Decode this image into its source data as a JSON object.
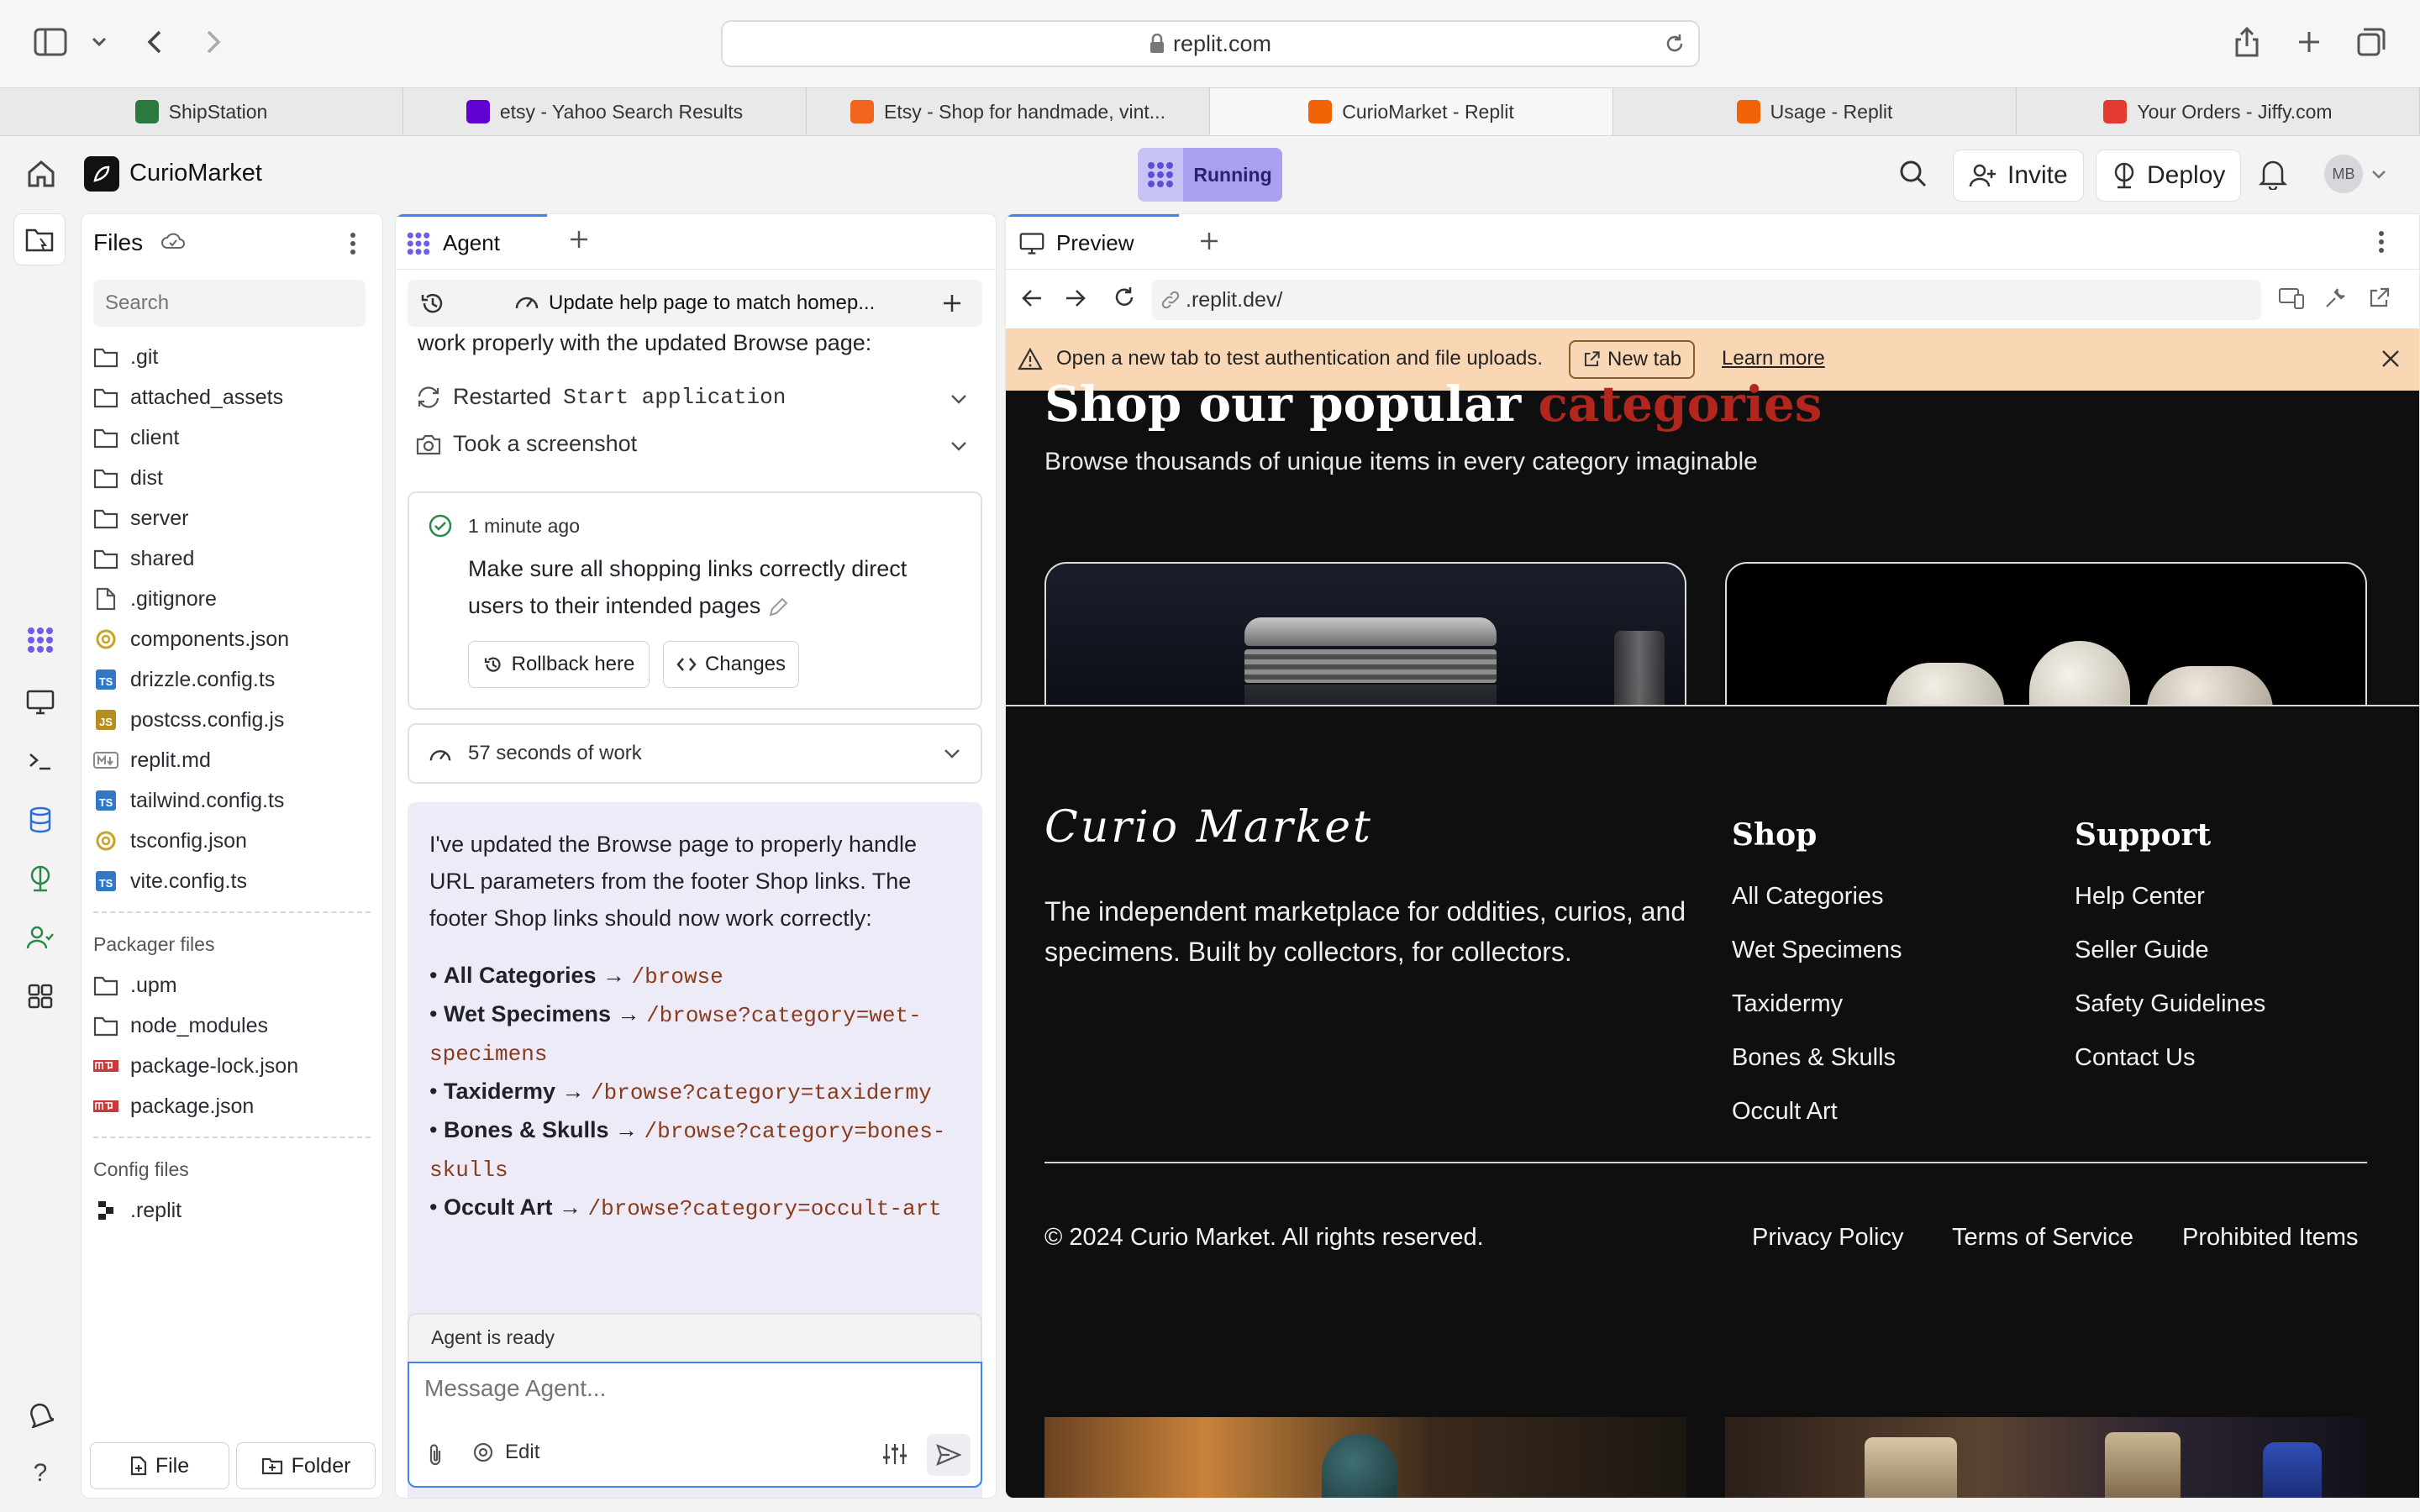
{
  "browser": {
    "url": "replit.com",
    "tabs": [
      {
        "label": "ShipStation",
        "favicon": "shipstation-icon",
        "color": "#2b7a3d",
        "active": false
      },
      {
        "label": "etsy - Yahoo Search Results",
        "favicon": "yahoo-icon",
        "color": "#6001d2",
        "active": false
      },
      {
        "label": "Etsy - Shop for handmade, vint...",
        "favicon": "etsy-icon",
        "color": "#f1641e",
        "active": false
      },
      {
        "label": "CurioMarket - Replit",
        "favicon": "replit-icon",
        "color": "#f26207",
        "active": true
      },
      {
        "label": "Usage - Replit",
        "favicon": "replit-icon",
        "color": "#f26207",
        "active": false
      },
      {
        "label": "Your Orders - Jiffy.com",
        "favicon": "jiffy-icon",
        "color": "#e23a2e",
        "active": false
      }
    ]
  },
  "header": {
    "project_name": "CurioMarket",
    "run_status": "Running",
    "invite_label": "Invite",
    "deploy_label": "Deploy",
    "avatar_initials": "MB"
  },
  "files": {
    "title": "Files",
    "search_placeholder": "Search",
    "items": [
      {
        "name": ".git",
        "type": "folder"
      },
      {
        "name": "attached_assets",
        "type": "folder"
      },
      {
        "name": "client",
        "type": "folder"
      },
      {
        "name": "dist",
        "type": "folder"
      },
      {
        "name": "server",
        "type": "folder"
      },
      {
        "name": "shared",
        "type": "folder"
      },
      {
        "name": ".gitignore",
        "type": "file"
      },
      {
        "name": "components.json",
        "type": "json"
      },
      {
        "name": "drizzle.config.ts",
        "type": "ts"
      },
      {
        "name": "postcss.config.js",
        "type": "js"
      },
      {
        "name": "replit.md",
        "type": "md"
      },
      {
        "name": "tailwind.config.ts",
        "type": "ts"
      },
      {
        "name": "tsconfig.json",
        "type": "json"
      },
      {
        "name": "vite.config.ts",
        "type": "ts"
      }
    ],
    "packager_label": "Packager files",
    "packager_items": [
      {
        "name": ".upm",
        "type": "folder"
      },
      {
        "name": "node_modules",
        "type": "folder"
      },
      {
        "name": "package-lock.json",
        "type": "npm"
      },
      {
        "name": "package.json",
        "type": "npm"
      }
    ],
    "config_label": "Config files",
    "config_items": [
      {
        "name": ".replit",
        "type": "replit"
      }
    ],
    "new_file_label": "File",
    "new_folder_label": "Folder"
  },
  "agent": {
    "tab_label": "Agent",
    "thread_title": "Update help page to match homep...",
    "top_text": "work properly with the updated Browse page:",
    "action_restarted_prefix": "Restarted",
    "action_restarted_cmd": "Start application",
    "action_screenshot": "Took a screenshot",
    "checkpoint_time": "1 minute ago",
    "checkpoint_text": "Make sure all shopping links correctly direct users to their intended pages",
    "rollback_label": "Rollback here",
    "changes_label": "Changes",
    "work_summary": "57 seconds of work",
    "message_intro": "I've updated the Browse page to properly handle URL parameters from the footer Shop links. The footer Shop links should now work correctly:",
    "routes": [
      {
        "label": "All Categories",
        "path": "/browse"
      },
      {
        "label": "Wet Specimens",
        "path": "/browse?category=wet-specimens"
      },
      {
        "label": "Taxidermy",
        "path": "/browse?category=taxidermy"
      },
      {
        "label": "Bones & Skulls",
        "path": "/browse?category=bones-skulls"
      },
      {
        "label": "Occult Art",
        "path": "/browse?category=occult-art"
      }
    ],
    "status": "Agent is ready",
    "input_placeholder": "Message Agent...",
    "edit_label": "Edit"
  },
  "preview": {
    "tab_label": "Preview",
    "url": ".replit.dev/",
    "banner_text": "Open a new tab to test authentication and file uploads.",
    "banner_newtab": "New tab",
    "banner_learn": "Learn more",
    "site": {
      "heading_main": "Shop our popular",
      "heading_accent": "categories",
      "subheading": "Browse thousands of unique items in every category imaginable",
      "logo_text": "Curio Market",
      "tagline": "The independent marketplace for oddities, curios, and specimens. Built by collectors, for collectors.",
      "shop_heading": "Shop",
      "shop_links": [
        "All Categories",
        "Wet Specimens",
        "Taxidermy",
        "Bones & Skulls",
        "Occult Art"
      ],
      "support_heading": "Support",
      "support_links": [
        "Help Center",
        "Seller Guide",
        "Safety Guidelines",
        "Contact Us"
      ],
      "copyright": "© 2024 Curio Market. All rights reserved.",
      "legal_links": [
        "Privacy Policy",
        "Terms of Service",
        "Prohibited Items"
      ],
      "accent_color": "#b3261e"
    }
  }
}
